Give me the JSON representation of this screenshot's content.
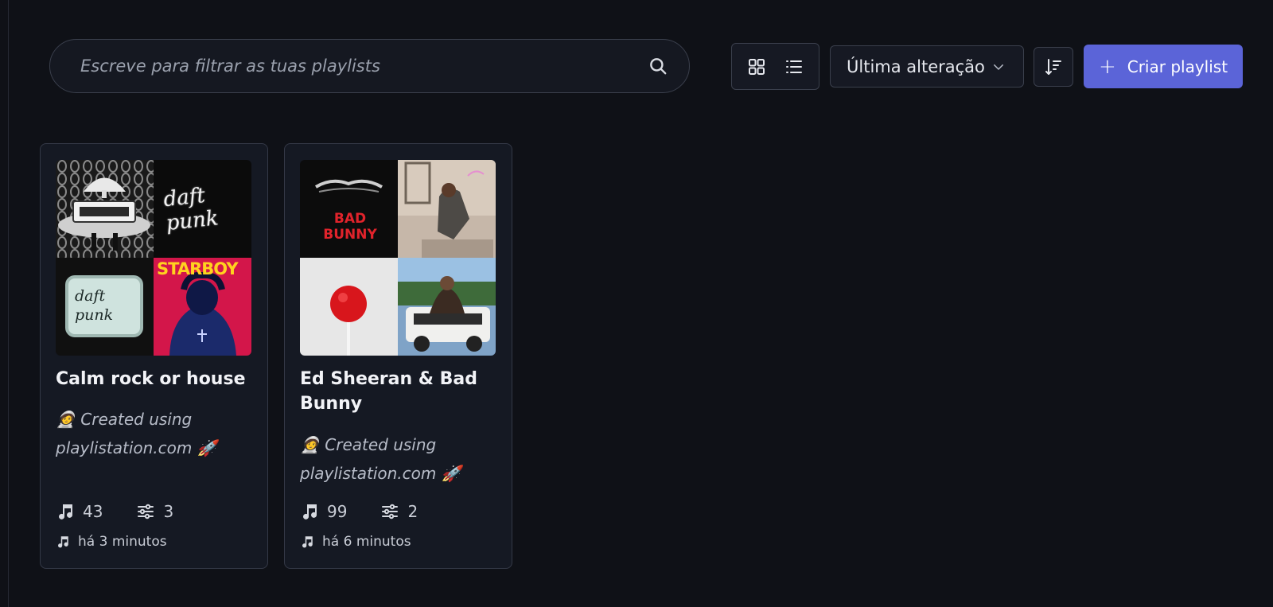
{
  "search": {
    "placeholder": "Escreve para filtrar as tuas playlists",
    "icon": "search-icon"
  },
  "view_toggle": {
    "grid_icon": "grid-view-icon",
    "list_icon": "list-view-icon"
  },
  "sort": {
    "selected": "Última alteração",
    "icon": "chevron-down-icon",
    "order_icon": "sort-descending-icon"
  },
  "create_button": {
    "label": "Criar playlist",
    "icon": "plus-icon"
  },
  "colors": {
    "background": "#0f1117",
    "card": "#151923",
    "accent": "#5b64d8",
    "border": "#343947"
  },
  "playlists": [
    {
      "title": "Calm rock or house",
      "description": "🧑‍🚀 Created using playlistation.com 🚀",
      "track_count": "43",
      "filter_count": "3",
      "updated": "há 3 minutos",
      "cover_labels": [
        "daft punk",
        "daft punk",
        "STARBOY"
      ]
    },
    {
      "title": "Ed Sheeran & Bad Bunny",
      "description": "🧑‍🚀 Created using playlistation.com 🚀",
      "track_count": "99",
      "filter_count": "2",
      "updated": "há 6 minutos",
      "cover_labels": [
        "BAD BUNNY"
      ]
    }
  ]
}
